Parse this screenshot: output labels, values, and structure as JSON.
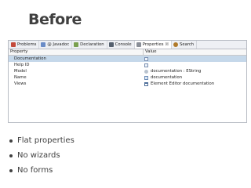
{
  "slide": {
    "title": "Before",
    "bullets": [
      "Flat properties",
      "No wizards",
      "No forms"
    ]
  },
  "views": {
    "tabs": [
      {
        "label": "Problems",
        "icon": "problems-icon",
        "color": "#c44a3a"
      },
      {
        "label": "@ Javadoc",
        "icon": "javadoc-icon",
        "color": "#6a8cc7"
      },
      {
        "label": "Declaration",
        "icon": "declaration-icon",
        "color": "#7aa04f"
      },
      {
        "label": "Console",
        "icon": "console-icon",
        "color": "#55606e"
      },
      {
        "label": "Properties",
        "icon": "properties-icon",
        "color": "#8a8f98",
        "active": true,
        "close": "☒"
      },
      {
        "label": "Search",
        "icon": "search-icon",
        "color": "#b07a2a"
      }
    ]
  },
  "properties": {
    "columns": {
      "property": "Property",
      "value": "Value"
    },
    "rows": [
      {
        "property": "Documentation",
        "value": "",
        "value_icon": "text-icon",
        "selected": true
      },
      {
        "property": "Help ID",
        "value": "",
        "value_icon": "text-icon"
      },
      {
        "property": "Model",
        "value": "documentation : EString",
        "value_icon": "attribute-icon"
      },
      {
        "property": "Name",
        "value": "documentation",
        "value_icon": "name-icon"
      },
      {
        "property": "Views",
        "value": "Element Editor documentation",
        "value_icon": "view-icon"
      }
    ]
  }
}
